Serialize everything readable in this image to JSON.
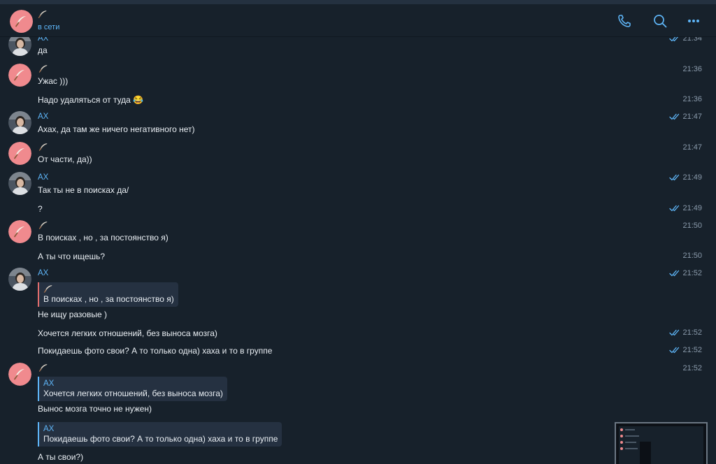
{
  "header": {
    "name_icon": "feather-icon",
    "status": "в сети",
    "icons": [
      "phone-icon",
      "search-icon",
      "more-icon"
    ],
    "accent": "#5eb5f7"
  },
  "messages": [
    {
      "sender": "AX",
      "text": "да",
      "time": "21:34",
      "read": true
    },
    {
      "sender_icon": "feather-icon",
      "text": "Ужас )))",
      "time": "21:36"
    },
    {
      "text": "Надо удаляться от туда 😂",
      "time": "21:36"
    },
    {
      "sender": "AX",
      "text": "Ахах, да там же ничего негативного нет)",
      "time": "21:47",
      "read": true
    },
    {
      "sender_icon": "feather-icon",
      "text": "От части, да))",
      "time": "21:47"
    },
    {
      "sender": "AX",
      "text": "Так ты не в поисках да/",
      "time": "21:49",
      "read": true
    },
    {
      "text": "?",
      "time": "21:49",
      "read": true
    },
    {
      "sender_icon": "feather-icon",
      "text": "В поисках , но , за постоянство я)",
      "time": "21:50"
    },
    {
      "text": "А ты что ищешь?",
      "time": "21:50"
    },
    {
      "sender": "AX",
      "quote": {
        "sender_icon": "feather-icon",
        "text": "В поисках , но , за постоянство я)"
      },
      "text": "Не ищу разовые )",
      "time": "21:52",
      "read": true
    },
    {
      "text": "Хочется легких отношений, без выноса мозга)",
      "time": "21:52",
      "read": true
    },
    {
      "text": "Покидаешь фото свои? А то только одна) хаха и то в группе",
      "time": "21:52",
      "read": true
    },
    {
      "sender_icon": "feather-icon",
      "quote": {
        "sender": "AX",
        "text": "Хочется легких отношений, без выноса мозга)"
      },
      "text": "Вынос мозга точно не нужен)",
      "time": "21:52"
    },
    {
      "quote": {
        "sender": "AX",
        "text": "Покидаешь фото свои? А то только одна) хаха и то в группе"
      },
      "text": "А ты свои?)"
    }
  ]
}
